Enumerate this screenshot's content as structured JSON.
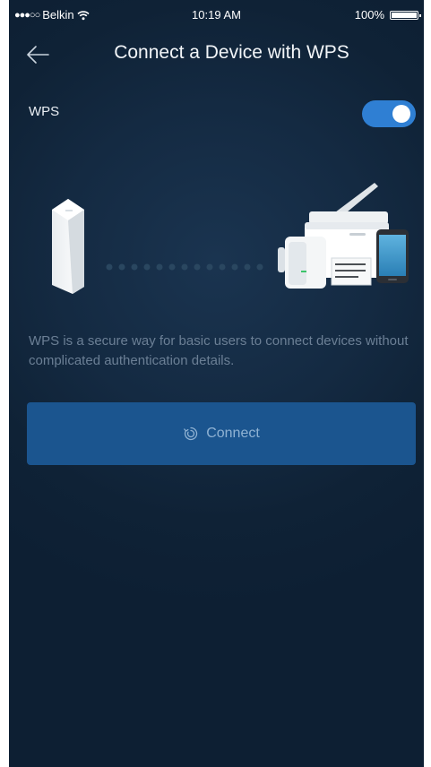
{
  "status_bar": {
    "signal_dots": "●●●○○",
    "carrier": "Belkin",
    "time": "10:19 AM",
    "battery_percent": "100%",
    "battery_level": 1.0
  },
  "header": {
    "back_icon": "arrow-left-icon",
    "title": "Connect a Device with WPS"
  },
  "wps": {
    "label": "WPS",
    "enabled": true
  },
  "description": "WPS is a secure way for basic users to connect devices without complicated authentication details.",
  "connect_button": {
    "icon": "wps-icon",
    "label": "Connect"
  },
  "colors": {
    "background": "#132940",
    "toggle_on": "#2f7fd3",
    "button": "#1b558f",
    "button_text": "#8fb2d3",
    "description_text": "#6b7f95"
  }
}
